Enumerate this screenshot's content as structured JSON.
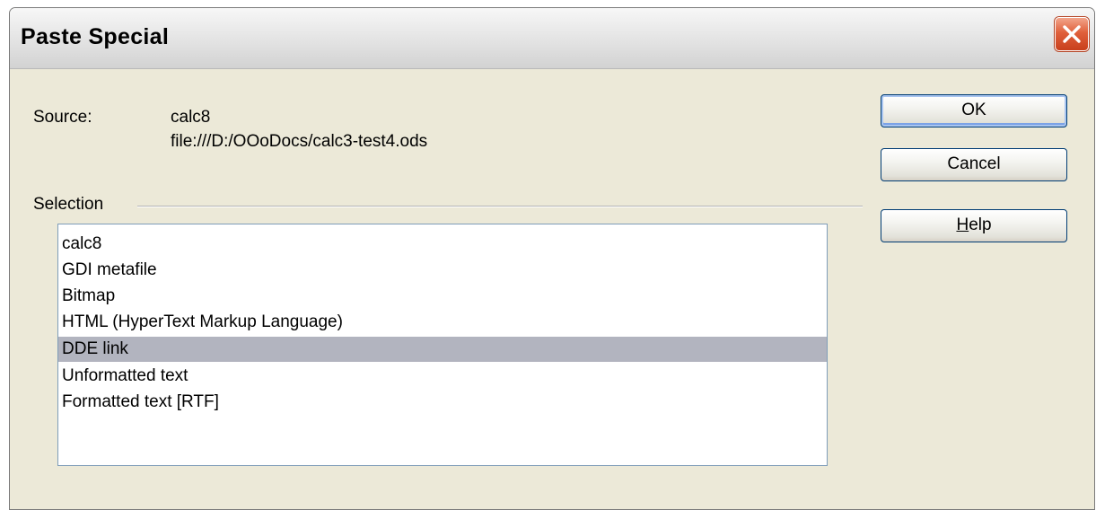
{
  "window": {
    "title": "Paste Special"
  },
  "source": {
    "label": "Source:",
    "app": "calc8",
    "file": "file:///D:/OOoDocs/calc3-test4.ods"
  },
  "selection": {
    "label": "Selection",
    "items": [
      "calc8",
      "GDI metafile",
      "Bitmap",
      "HTML (HyperText Markup Language)",
      "DDE link",
      "Unformatted text",
      "Formatted text [RTF]"
    ],
    "selected": "DDE link"
  },
  "buttons": {
    "ok_label": "OK",
    "cancel_label": "Cancel",
    "help_mnemonic": "H",
    "help_rest": "elp"
  },
  "icons": {
    "close": "close-icon"
  },
  "colors": {
    "dialog_bg": "#ece9d8",
    "selected_row": "#b2b4bf",
    "close_red": "#d9532f",
    "button_border": "#003c74"
  }
}
